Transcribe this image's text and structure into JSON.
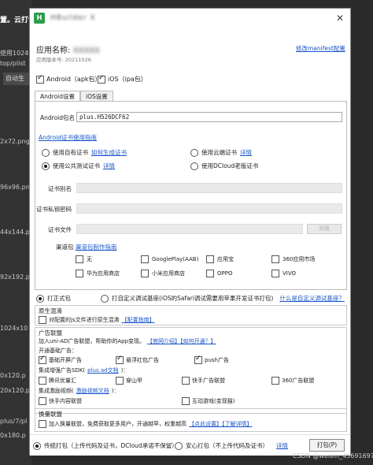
{
  "background": {
    "top_text": "置。云打包",
    "side_texts": [
      "使用1024x",
      "top/plist",
      "2x72.png",
      "96x96.png",
      "44x144.p",
      "92x192.p",
      "1024x10",
      "0x120.p",
      "20x120.p",
      "plus/7/pl",
      "0x180.p"
    ],
    "button_label": "自动生"
  },
  "dialog": {
    "title": "HBuilder X",
    "close_icon": "✕",
    "app_name_label": "应用名称:",
    "app_name_value": "XXXXX",
    "app_version": "应用版本号: 20211026",
    "manifest_link": "修改manifest配置",
    "android_check_label": "Android（apk包）",
    "ios_check_label": "iOS（ipa包）",
    "tabs": [
      "Android设置",
      "iOS设置"
    ],
    "android": {
      "package_label": "Android包名",
      "package_value": "plus.H526DCF62",
      "cert_guide_link": "Android证书使用指南",
      "cert_own_label": "使用自有证书",
      "cert_own_link": "如何生成证书",
      "cert_cloud_label": "使用云端证书",
      "cert_cloud_link": "详情",
      "cert_public_label": "使用公共测试证书",
      "cert_public_link": "详情",
      "cert_dcloud_label": "使用DCloud老版证书",
      "alias_label": "证书别名",
      "password_label": "证书私钥密码",
      "file_label": "证书文件",
      "browse_label": "浏览",
      "channel_label": "渠道包",
      "channel_link": "渠道包制作指南",
      "channels": [
        "无",
        "GooglePlay(AAB)",
        "应用宝",
        "360应用市场",
        "华为应用商店",
        "小米应用商店",
        "OPPO",
        "VIVO"
      ]
    },
    "build_type": {
      "formal_label": "打正式包",
      "custom_label": "打自定义调试基座(iOS的Safari调试需要用苹果开发证书打包)",
      "custom_link": "什么是自定义调试基座？"
    },
    "obfuscation": {
      "title": "原生混淆",
      "check_label": "对配置的js文件进行原生混淆",
      "link": "【配置指南】"
    },
    "ads": {
      "title": "广告联盟",
      "desc": "加入uni-AD广告联盟，帮助你的App变现。",
      "desc_links": "【官网介绍】【如何开通？】",
      "basic_title": "开通基础广告：",
      "basic_items": [
        "基础开屏广告",
        "悬浮红包广告",
        "push广告"
      ],
      "enhanced_title": "集成增强广告SDK(",
      "enhanced_link": "plus.ad文档",
      "enhanced_suffix": ")：",
      "enhanced_items": [
        "腾讯优量汇",
        "穿山甲",
        "快手广告联盟",
        "360广告联盟"
      ],
      "video_title": "集成激励视频(",
      "video_link": "激励视频文档",
      "video_suffix": ")：",
      "video_items": [
        "快手内容联盟",
        "互动游戏(变现猫)"
      ]
    },
    "exchange": {
      "title": "换量联盟",
      "check_label": "加入换量联盟，免费获取更多用户，开通越早，权重越高",
      "links": "【点此设置】【了解详情】"
    },
    "bottom": {
      "traditional_label": "传统打包（上传代码及证书，DCloud承诺不保留）",
      "safe_label": "安心打包（不上传代码及证书）",
      "detail_link": "详情",
      "pack_button": "打包(P)"
    }
  },
  "watermark": "CSDN @weixin_45691697"
}
